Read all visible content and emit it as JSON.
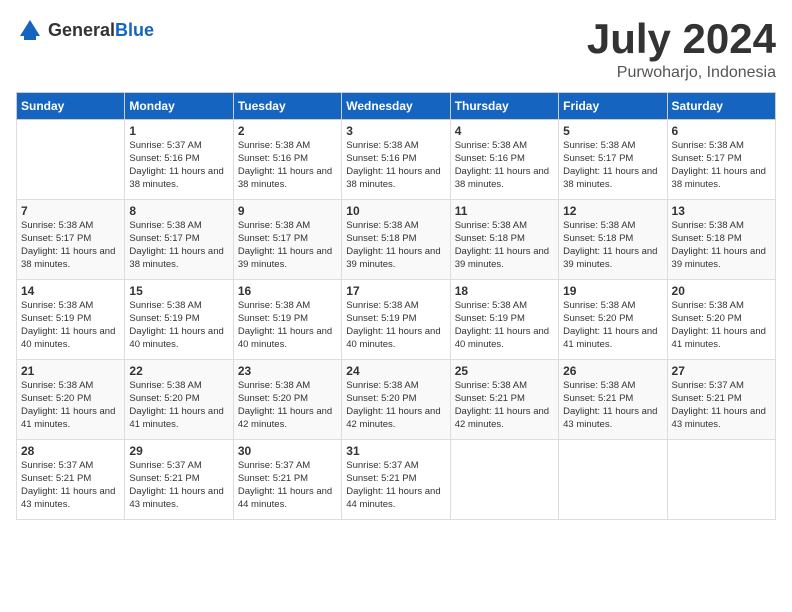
{
  "header": {
    "logo_general": "General",
    "logo_blue": "Blue",
    "month_year": "July 2024",
    "location": "Purwoharjo, Indonesia"
  },
  "days_of_week": [
    "Sunday",
    "Monday",
    "Tuesday",
    "Wednesday",
    "Thursday",
    "Friday",
    "Saturday"
  ],
  "weeks": [
    [
      {
        "day": "",
        "info": ""
      },
      {
        "day": "1",
        "info": "Sunrise: 5:37 AM\nSunset: 5:16 PM\nDaylight: 11 hours\nand 38 minutes."
      },
      {
        "day": "2",
        "info": "Sunrise: 5:38 AM\nSunset: 5:16 PM\nDaylight: 11 hours\nand 38 minutes."
      },
      {
        "day": "3",
        "info": "Sunrise: 5:38 AM\nSunset: 5:16 PM\nDaylight: 11 hours\nand 38 minutes."
      },
      {
        "day": "4",
        "info": "Sunrise: 5:38 AM\nSunset: 5:16 PM\nDaylight: 11 hours\nand 38 minutes."
      },
      {
        "day": "5",
        "info": "Sunrise: 5:38 AM\nSunset: 5:17 PM\nDaylight: 11 hours\nand 38 minutes."
      },
      {
        "day": "6",
        "info": "Sunrise: 5:38 AM\nSunset: 5:17 PM\nDaylight: 11 hours\nand 38 minutes."
      }
    ],
    [
      {
        "day": "7",
        "info": ""
      },
      {
        "day": "8",
        "info": "Sunrise: 5:38 AM\nSunset: 5:17 PM\nDaylight: 11 hours\nand 38 minutes."
      },
      {
        "day": "9",
        "info": "Sunrise: 5:38 AM\nSunset: 5:17 PM\nDaylight: 11 hours\nand 39 minutes."
      },
      {
        "day": "10",
        "info": "Sunrise: 5:38 AM\nSunset: 5:18 PM\nDaylight: 11 hours\nand 39 minutes."
      },
      {
        "day": "11",
        "info": "Sunrise: 5:38 AM\nSunset: 5:18 PM\nDaylight: 11 hours\nand 39 minutes."
      },
      {
        "day": "12",
        "info": "Sunrise: 5:38 AM\nSunset: 5:18 PM\nDaylight: 11 hours\nand 39 minutes."
      },
      {
        "day": "13",
        "info": "Sunrise: 5:38 AM\nSunset: 5:18 PM\nDaylight: 11 hours\nand 39 minutes."
      }
    ],
    [
      {
        "day": "14",
        "info": ""
      },
      {
        "day": "15",
        "info": "Sunrise: 5:38 AM\nSunset: 5:19 PM\nDaylight: 11 hours\nand 40 minutes."
      },
      {
        "day": "16",
        "info": "Sunrise: 5:38 AM\nSunset: 5:19 PM\nDaylight: 11 hours\nand 40 minutes."
      },
      {
        "day": "17",
        "info": "Sunrise: 5:38 AM\nSunset: 5:19 PM\nDaylight: 11 hours\nand 40 minutes."
      },
      {
        "day": "18",
        "info": "Sunrise: 5:38 AM\nSunset: 5:19 PM\nDaylight: 11 hours\nand 40 minutes."
      },
      {
        "day": "19",
        "info": "Sunrise: 5:38 AM\nSunset: 5:20 PM\nDaylight: 11 hours\nand 41 minutes."
      },
      {
        "day": "20",
        "info": "Sunrise: 5:38 AM\nSunset: 5:20 PM\nDaylight: 11 hours\nand 41 minutes."
      }
    ],
    [
      {
        "day": "21",
        "info": ""
      },
      {
        "day": "22",
        "info": "Sunrise: 5:38 AM\nSunset: 5:20 PM\nDaylight: 11 hours\nand 41 minutes."
      },
      {
        "day": "23",
        "info": "Sunrise: 5:38 AM\nSunset: 5:20 PM\nDaylight: 11 hours\nand 42 minutes."
      },
      {
        "day": "24",
        "info": "Sunrise: 5:38 AM\nSunset: 5:20 PM\nDaylight: 11 hours\nand 42 minutes."
      },
      {
        "day": "25",
        "info": "Sunrise: 5:38 AM\nSunset: 5:21 PM\nDaylight: 11 hours\nand 42 minutes."
      },
      {
        "day": "26",
        "info": "Sunrise: 5:38 AM\nSunset: 5:21 PM\nDaylight: 11 hours\nand 43 minutes."
      },
      {
        "day": "27",
        "info": "Sunrise: 5:37 AM\nSunset: 5:21 PM\nDaylight: 11 hours\nand 43 minutes."
      }
    ],
    [
      {
        "day": "28",
        "info": "Sunrise: 5:37 AM\nSunset: 5:21 PM\nDaylight: 11 hours\nand 43 minutes."
      },
      {
        "day": "29",
        "info": "Sunrise: 5:37 AM\nSunset: 5:21 PM\nDaylight: 11 hours\nand 43 minutes."
      },
      {
        "day": "30",
        "info": "Sunrise: 5:37 AM\nSunset: 5:21 PM\nDaylight: 11 hours\nand 44 minutes."
      },
      {
        "day": "31",
        "info": "Sunrise: 5:37 AM\nSunset: 5:21 PM\nDaylight: 11 hours\nand 44 minutes."
      },
      {
        "day": "",
        "info": ""
      },
      {
        "day": "",
        "info": ""
      },
      {
        "day": "",
        "info": ""
      }
    ]
  ],
  "week1_sunday_info": "Sunrise: 5:38 AM\nSunset: 5:17 PM\nDaylight: 11 hours\nand 38 minutes.",
  "week2_sunday_info": "Sunrise: 5:38 AM\nSunset: 5:17 PM\nDaylight: 11 hours\nand 38 minutes.",
  "week3_sunday_info": "Sunrise: 5:38 AM\nSunset: 5:19 PM\nDaylight: 11 hours\nand 40 minutes.",
  "week4_sunday_info": "Sunrise: 5:38 AM\nSunset: 5:20 PM\nDaylight: 11 hours\nand 41 minutes."
}
